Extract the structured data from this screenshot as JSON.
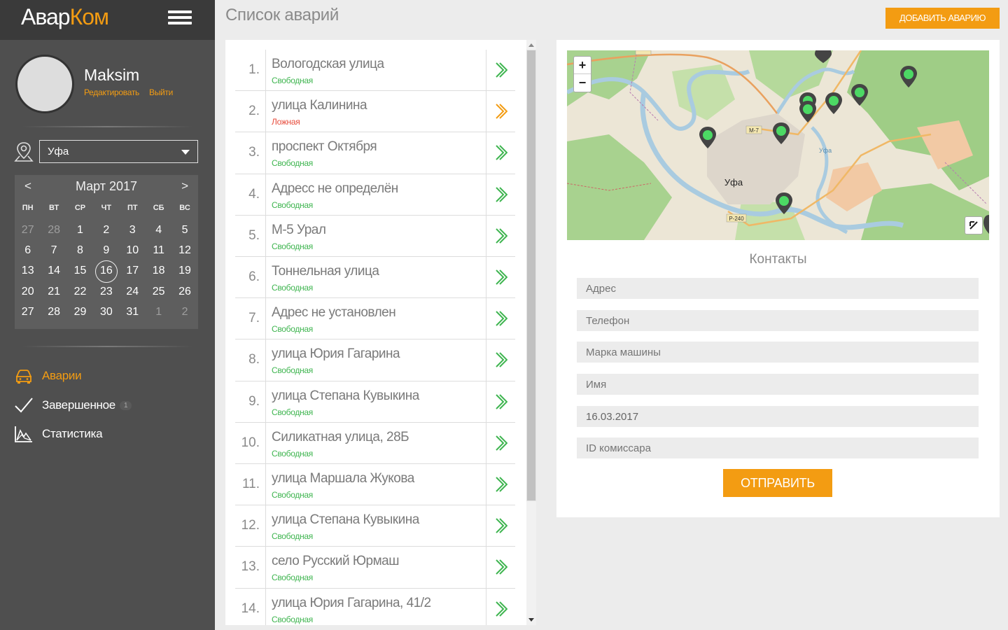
{
  "app": {
    "logo_part1": "Авар",
    "logo_part2": "Ком",
    "accent_color": "#f39c12"
  },
  "profile": {
    "name": "Maksim",
    "edit_link": "Редактировать",
    "logout_link": "Выйти"
  },
  "city": {
    "selected": "Уфа",
    "icon": "map-pin-icon"
  },
  "calendar": {
    "title": "Март 2017",
    "prev": "<",
    "next": ">",
    "weekdays": [
      "ПН",
      "ВТ",
      "СР",
      "ЧТ",
      "ПТ",
      "СБ",
      "ВС"
    ],
    "weeks": [
      [
        {
          "d": "27",
          "m": true
        },
        {
          "d": "28",
          "m": true
        },
        {
          "d": "1"
        },
        {
          "d": "2"
        },
        {
          "d": "3"
        },
        {
          "d": "4"
        },
        {
          "d": "5"
        }
      ],
      [
        {
          "d": "6"
        },
        {
          "d": "7"
        },
        {
          "d": "8"
        },
        {
          "d": "9"
        },
        {
          "d": "10"
        },
        {
          "d": "11"
        },
        {
          "d": "12"
        }
      ],
      [
        {
          "d": "13"
        },
        {
          "d": "14"
        },
        {
          "d": "15"
        },
        {
          "d": "16",
          "today": true
        },
        {
          "d": "17"
        },
        {
          "d": "18"
        },
        {
          "d": "19"
        }
      ],
      [
        {
          "d": "20"
        },
        {
          "d": "21"
        },
        {
          "d": "22"
        },
        {
          "d": "23"
        },
        {
          "d": "24"
        },
        {
          "d": "25"
        },
        {
          "d": "26"
        }
      ],
      [
        {
          "d": "27"
        },
        {
          "d": "28"
        },
        {
          "d": "29"
        },
        {
          "d": "30"
        },
        {
          "d": "31"
        },
        {
          "d": "1",
          "m": true
        },
        {
          "d": "2",
          "m": true
        }
      ]
    ]
  },
  "nav": {
    "items": [
      {
        "label": "Аварии",
        "icon": "car-icon",
        "active": true
      },
      {
        "label": "Завершенное",
        "icon": "checkmark-icon",
        "badge": "1"
      },
      {
        "label": "Статистика",
        "icon": "chart-icon"
      }
    ]
  },
  "header": {
    "title": "Список аварий",
    "add_button": "ДОБАВИТЬ АВАРИЮ"
  },
  "accidents": [
    {
      "num": "1.",
      "address": "Вологодская улица",
      "status": "Свободная",
      "kind": "free"
    },
    {
      "num": "2.",
      "address": "улица Калинина",
      "status": "Ложная",
      "kind": "false"
    },
    {
      "num": "3.",
      "address": "проспект Октября",
      "status": "Свободная",
      "kind": "free"
    },
    {
      "num": "4.",
      "address": "Адресс не определён",
      "status": "Свободная",
      "kind": "free"
    },
    {
      "num": "5.",
      "address": "М-5 Урал",
      "status": "Свободная",
      "kind": "free"
    },
    {
      "num": "6.",
      "address": "Тоннельная улица",
      "status": "Свободная",
      "kind": "free"
    },
    {
      "num": "7.",
      "address": "Адрес не установлен",
      "status": "Свободная",
      "kind": "free"
    },
    {
      "num": "8.",
      "address": "улица Юрия Гагарина",
      "status": "Свободная",
      "kind": "free"
    },
    {
      "num": "9.",
      "address": "улица Степана Кувыкина",
      "status": "Свободная",
      "kind": "free"
    },
    {
      "num": "10.",
      "address": "Силикатная улица, 28Б",
      "status": "Свободная",
      "kind": "free"
    },
    {
      "num": "11.",
      "address": "улица Маршала Жукова",
      "status": "Свободная",
      "kind": "free"
    },
    {
      "num": "12.",
      "address": "улица Степана Кувыкина",
      "status": "Свободная",
      "kind": "free"
    },
    {
      "num": "13.",
      "address": "село Русский Юрмаш",
      "status": "Свободная",
      "kind": "free"
    },
    {
      "num": "14.",
      "address": "улица Юрия Гагарина, 41/2",
      "status": "Свободная",
      "kind": "free"
    }
  ],
  "status_colors": {
    "free": "#3fb550",
    "false": "#e74c3c"
  },
  "map": {
    "zoom_in": "+",
    "zoom_out": "−",
    "city_label": "Уфа",
    "road_labels": [
      "М-7",
      "Р-240",
      "М-7",
      "Уфа"
    ]
  },
  "contacts": {
    "title": "Контакты",
    "address_placeholder": "Адрес",
    "phone_placeholder": "Телефон",
    "car_placeholder": "Марка машины",
    "name_placeholder": "Имя",
    "date_value": "16.03.2017",
    "commissar_placeholder": "ID комиссара",
    "submit": "ОТПРАВИТЬ"
  }
}
